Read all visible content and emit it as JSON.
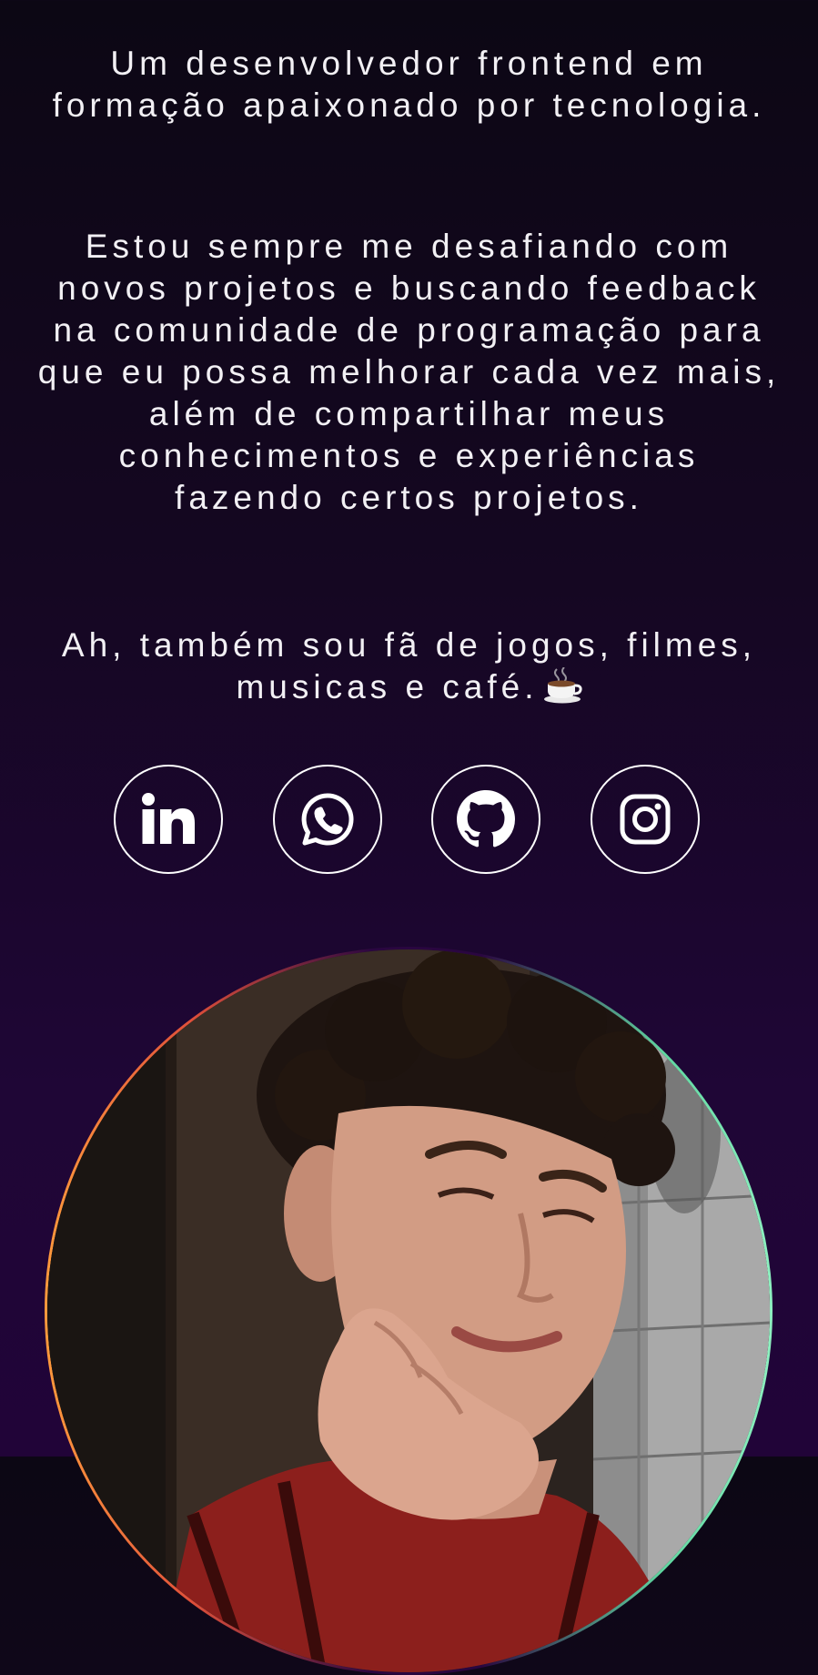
{
  "bio": {
    "paragraph1": "Um desenvolvedor frontend em formação apaixonado por tecnologia.",
    "paragraph2": "Estou sempre me desafiando com novos projetos e buscando feedback na comunidade de programação para que eu possa melhorar cada vez mais, além de compartilhar meus conhecimentos e experiências fazendo certos projetos.",
    "paragraph3": "Ah, também sou fã de jogos, filmes, musicas e café."
  },
  "social": {
    "items": [
      {
        "name": "LinkedIn",
        "icon": "linkedin-icon"
      },
      {
        "name": "WhatsApp",
        "icon": "whatsapp-icon"
      },
      {
        "name": "GitHub",
        "icon": "github-icon"
      },
      {
        "name": "Instagram",
        "icon": "instagram-icon"
      }
    ],
    "border_color": "#ffffff"
  },
  "profile_photo": {
    "ring_colors": [
      "#ff9a3c",
      "#e0503a",
      "#5fd6a0",
      "#8ef0c0"
    ]
  },
  "colors": {
    "background_top": "#0c0714",
    "background_bottom": "#210438",
    "text": "#f2f0f4"
  }
}
